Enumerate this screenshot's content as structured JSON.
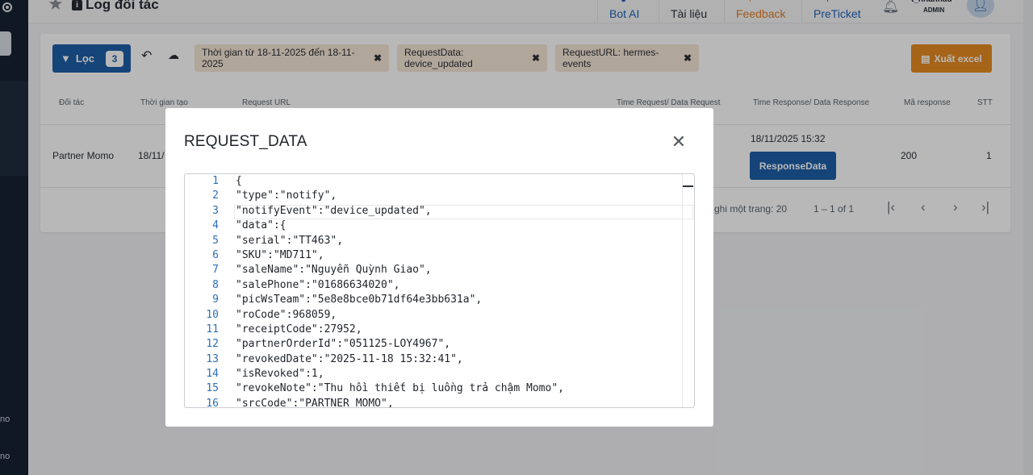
{
  "sidebar": {
    "text1": "no",
    "text2": "no"
  },
  "header": {
    "title": "Log đối tác",
    "nav": [
      {
        "label": "Bot AI"
      },
      {
        "label": "Tài liệu"
      },
      {
        "label": "Feedback"
      },
      {
        "label": "PreTicket"
      }
    ],
    "user_name": "t_nhanhau",
    "user_role": "ADMIN"
  },
  "toolbar": {
    "filter_label": "Lọc",
    "filter_count": "3",
    "chips": [
      "Thời gian từ 18-11-2025 đến 18-11-2025",
      "RequestData: device_updated",
      "RequestURL: hermes-events"
    ],
    "export_label": "Xuất excel"
  },
  "table": {
    "headers": [
      "Đối tác",
      "Thời gian tạo",
      "Request URL",
      "Time Request/ Data Request",
      "Time Response/ Data Response",
      "Mã response",
      "STT"
    ],
    "row": {
      "partner": "Partner Momo",
      "created": "18/11/",
      "response_time": "18/11/2025 15:32",
      "response_button": "ResponseData",
      "code": "200",
      "stt": "1"
    }
  },
  "pagination": {
    "per_page": "ghi một trang: 20",
    "range": "1 – 1 of 1"
  },
  "modal": {
    "title": "REQUEST_DATA",
    "line_numbers": [
      "1",
      "2",
      "3",
      "4",
      "5",
      "6",
      "7",
      "8",
      "9",
      "10",
      "11",
      "12",
      "13",
      "14",
      "15",
      "16"
    ],
    "lines": [
      "{",
      "\"type\":\"notify\",",
      "\"notifyEvent\":\"device_updated\",",
      "\"data\":{",
      "\"serial\":\"TT463\",",
      "\"SKU\":\"MD711\",",
      "\"saleName\":\"Nguyễn Quỳnh Giao\",",
      "\"salePhone\":\"01686634020\",",
      "\"picWsTeam\":\"5e8e8bce0b71df64e3bb631a\",",
      "\"roCode\":968059,",
      "\"receiptCode\":27952,",
      "\"partnerOrderId\":\"051125-LOY4967\",",
      "\"revokedDate\":\"2025-11-18 15:32:41\",",
      "\"isRevoked\":1,",
      "\"revokeNote\":\"Thu hồi thiết bị luồng trả chậm Momo\",",
      "\"srcCode\":\"PARTNER_MOMO\","
    ]
  }
}
